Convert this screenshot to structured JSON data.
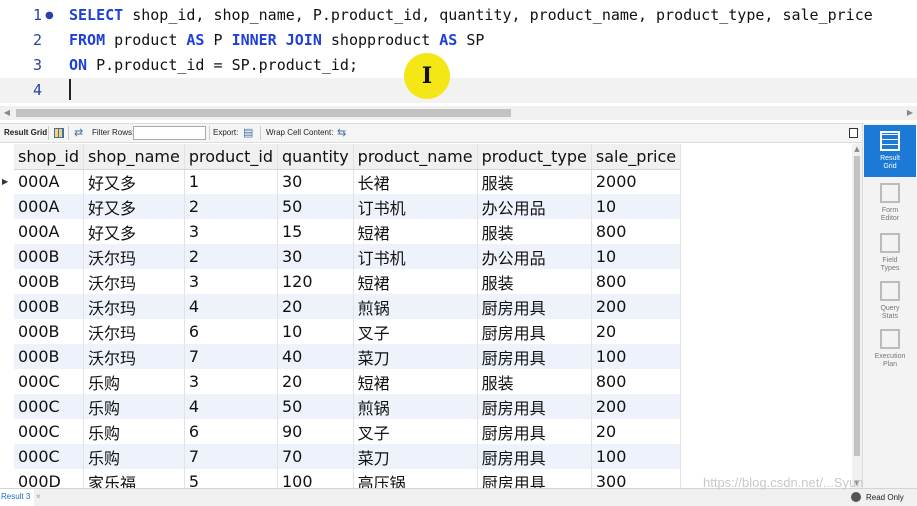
{
  "editor": {
    "lines": [
      {
        "number": "1",
        "marker": "●",
        "text": "SELECT shop_id, shop_name, P.product_id, quantity, product_name, product_type, sale_price"
      },
      {
        "number": "2",
        "text": "FROM product AS P INNER JOIN shopproduct AS SP"
      },
      {
        "number": "3",
        "text": "ON P.product_id = SP.product_id;"
      },
      {
        "number": "4",
        "text": ""
      }
    ],
    "keywords": [
      "SELECT",
      "FROM",
      "AS",
      "INNER",
      "JOIN",
      "ON"
    ],
    "cursor_glyph": "I"
  },
  "toolbar": {
    "result_grid_label": "Result Grid",
    "filter_rows_label": "Filter Rows:",
    "filter_rows_value": "",
    "export_label": "Export:",
    "wrap_cell_label": "Wrap Cell Content:"
  },
  "grid": {
    "columns": [
      "shop_id",
      "shop_name",
      "product_id",
      "quantity",
      "product_name",
      "product_type",
      "sale_price"
    ],
    "rows": [
      [
        "000A",
        "好又多",
        "1",
        "30",
        "长裙",
        "服装",
        "2000"
      ],
      [
        "000A",
        "好又多",
        "2",
        "50",
        "订书机",
        "办公用品",
        "10"
      ],
      [
        "000A",
        "好又多",
        "3",
        "15",
        "短裙",
        "服装",
        "800"
      ],
      [
        "000B",
        "沃尔玛",
        "2",
        "30",
        "订书机",
        "办公用品",
        "10"
      ],
      [
        "000B",
        "沃尔玛",
        "3",
        "120",
        "短裙",
        "服装",
        "800"
      ],
      [
        "000B",
        "沃尔玛",
        "4",
        "20",
        "煎锅",
        "厨房用具",
        "200"
      ],
      [
        "000B",
        "沃尔玛",
        "6",
        "10",
        "叉子",
        "厨房用具",
        "20"
      ],
      [
        "000B",
        "沃尔玛",
        "7",
        "40",
        "菜刀",
        "厨房用具",
        "100"
      ],
      [
        "000C",
        "乐购",
        "3",
        "20",
        "短裙",
        "服装",
        "800"
      ],
      [
        "000C",
        "乐购",
        "4",
        "50",
        "煎锅",
        "厨房用具",
        "200"
      ],
      [
        "000C",
        "乐购",
        "6",
        "90",
        "叉子",
        "厨房用具",
        "20"
      ],
      [
        "000C",
        "乐购",
        "7",
        "70",
        "菜刀",
        "厨房用具",
        "100"
      ],
      [
        "000D",
        "家乐福",
        "5",
        "100",
        "高压锅",
        "厨房用具",
        "300"
      ]
    ],
    "current_row_marker": "▶"
  },
  "side_panel": [
    {
      "label": "Result\nGrid",
      "active": true
    },
    {
      "label": "Form\nEditor",
      "active": false
    },
    {
      "label": "Field\nTypes",
      "active": false
    },
    {
      "label": "Query\nStats",
      "active": false
    },
    {
      "label": "Execution\nPlan",
      "active": false
    }
  ],
  "status": {
    "result_tab_label": "Result 3",
    "tab_close": "×",
    "readonly_label": "Read Only",
    "watermark": "https://blog.csdn.net/...Syun"
  },
  "colors": {
    "keyword": "#1f3fd9",
    "line_number": "#2b3fa8",
    "cursor_highlight": "#f5e616",
    "grid_alt_row": "#eef3fb",
    "side_active": "#1c7ad6"
  },
  "icons": {
    "result_grid": "grid-icon",
    "refresh": "refresh-icon",
    "export": "export-icon",
    "wrap": "wrap-icon",
    "panel_toggle": "panel-toggle-icon",
    "read_only": "lock-icon"
  }
}
